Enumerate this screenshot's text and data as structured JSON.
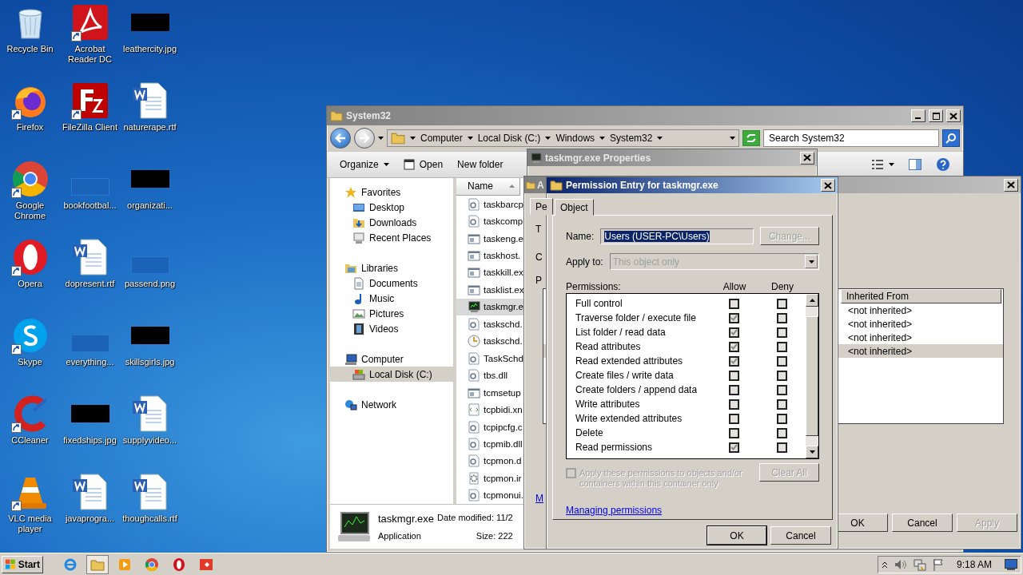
{
  "desktop_icons": [
    {
      "label": "Recycle Bin",
      "kind": "recycle",
      "shortcut": false
    },
    {
      "label": "Acrobat Reader DC",
      "kind": "pdf",
      "shortcut": true
    },
    {
      "label": "leathercity.jpg",
      "kind": "thumb-black",
      "shortcut": false
    },
    {
      "label": "Firefox",
      "kind": "firefox",
      "shortcut": true
    },
    {
      "label": "FileZilla Client",
      "kind": "filezilla",
      "shortcut": true
    },
    {
      "label": "naturerape.rtf",
      "kind": "word",
      "shortcut": false
    },
    {
      "label": "Google Chrome",
      "kind": "chrome",
      "shortcut": true
    },
    {
      "label": "bookfootbal...",
      "kind": "thumb-blue",
      "shortcut": false
    },
    {
      "label": "organizati...",
      "kind": "thumb-black",
      "shortcut": false
    },
    {
      "label": "Opera",
      "kind": "opera",
      "shortcut": true
    },
    {
      "label": "dopresent.rtf",
      "kind": "word",
      "shortcut": false
    },
    {
      "label": "passend.png",
      "kind": "thumb-blue",
      "shortcut": false
    },
    {
      "label": "Skype",
      "kind": "skype",
      "shortcut": true
    },
    {
      "label": "everything...",
      "kind": "thumb-blue",
      "shortcut": false
    },
    {
      "label": "skillsgirls.jpg",
      "kind": "thumb-black",
      "shortcut": false
    },
    {
      "label": "CCleaner",
      "kind": "ccleaner",
      "shortcut": true
    },
    {
      "label": "fixedships.jpg",
      "kind": "thumb-black",
      "shortcut": false
    },
    {
      "label": "supplyvideo...",
      "kind": "word",
      "shortcut": false
    },
    {
      "label": "VLC media player",
      "kind": "vlc",
      "shortcut": true
    },
    {
      "label": "javaprogra...",
      "kind": "word",
      "shortcut": false
    },
    {
      "label": "thoughcalls.rtf",
      "kind": "word",
      "shortcut": false
    }
  ],
  "explorer": {
    "title": "System32",
    "breadcrumb": [
      "Computer",
      "Local Disk (C:)",
      "Windows",
      "System32"
    ],
    "search": {
      "placeholder": "Search System32"
    },
    "toolbar": [
      {
        "label": "Organize",
        "kind": "menu"
      },
      {
        "label": "Open",
        "kind": "open"
      },
      {
        "label": "New folder",
        "kind": "plain"
      }
    ],
    "nav": [
      {
        "label": "Favorites",
        "kind": "star",
        "selected": false,
        "children": [
          {
            "label": "Desktop",
            "kind": "desktop",
            "selected": false
          },
          {
            "label": "Downloads",
            "kind": "downloads",
            "selected": false
          },
          {
            "label": "Recent Places",
            "kind": "recent",
            "selected": false
          }
        ]
      },
      {
        "label": "Libraries",
        "kind": "libraries",
        "selected": false,
        "children": [
          {
            "label": "Documents",
            "kind": "documents",
            "selected": false
          },
          {
            "label": "Music",
            "kind": "music",
            "selected": false
          },
          {
            "label": "Pictures",
            "kind": "pictures",
            "selected": false
          },
          {
            "label": "Videos",
            "kind": "videos",
            "selected": false
          }
        ]
      },
      {
        "label": "Computer",
        "kind": "computer",
        "selected": false,
        "children": [
          {
            "label": "Local Disk (C:)",
            "kind": "disk",
            "selected": true
          }
        ]
      },
      {
        "label": "Network",
        "kind": "network",
        "selected": false
      }
    ],
    "name_column": "Name",
    "files": [
      {
        "name": "taskbarcp",
        "kind": "dll",
        "selected": false
      },
      {
        "name": "taskcomp",
        "kind": "dll",
        "selected": false
      },
      {
        "name": "taskeng.e",
        "kind": "exe",
        "selected": false
      },
      {
        "name": "taskhost.",
        "kind": "exe",
        "selected": false
      },
      {
        "name": "taskkill.ex",
        "kind": "exe",
        "selected": false
      },
      {
        "name": "tasklist.ex",
        "kind": "exe",
        "selected": false
      },
      {
        "name": "taskmgr.e",
        "kind": "monitor",
        "selected": true
      },
      {
        "name": "taskschd.",
        "kind": "dll",
        "selected": false
      },
      {
        "name": "taskschd.",
        "kind": "clock",
        "selected": false
      },
      {
        "name": "TaskSchd",
        "kind": "dll",
        "selected": false
      },
      {
        "name": "tbs.dll",
        "kind": "dll",
        "selected": false
      },
      {
        "name": "tcmsetup",
        "kind": "exe",
        "selected": false
      },
      {
        "name": "tcpbidi.xn",
        "kind": "xml",
        "selected": false
      },
      {
        "name": "tcpipcfg.c",
        "kind": "dll",
        "selected": false
      },
      {
        "name": "tcpmib.dll",
        "kind": "dll",
        "selected": false
      },
      {
        "name": "tcpmon.d",
        "kind": "dll",
        "selected": false
      },
      {
        "name": "tcpmon.ir",
        "kind": "inf",
        "selected": false
      },
      {
        "name": "tcpmonui.",
        "kind": "dll",
        "selected": false
      }
    ],
    "details": {
      "name": "taskmgr.exe",
      "type": "Application",
      "date_modified": "Date modified: 11/2",
      "size": "Size: 222"
    }
  },
  "properties_window": {
    "title": "taskmgr.exe Properties"
  },
  "advanced_window": {
    "title": "A",
    "tab": "Pe",
    "labels": [
      "T",
      "C",
      "P"
    ],
    "column": "Inherited From",
    "rows": [
      {
        "inherited_from": "<not inherited>",
        "selected": false
      },
      {
        "inherited_from": "<not inherited>",
        "selected": false
      },
      {
        "inherited_from": "<not inherited>",
        "selected": false
      },
      {
        "inherited_from": "<not inherited>",
        "selected": true
      }
    ],
    "link": "M",
    "buttons": [
      {
        "label": "OK",
        "disabled": false
      },
      {
        "label": "Cancel",
        "disabled": false
      },
      {
        "label": "Apply",
        "disabled": true
      }
    ]
  },
  "permission_entry": {
    "title": "Permission Entry for taskmgr.exe",
    "tab": "Object",
    "name_label": "Name:",
    "name_value": "Users (USER-PC\\Users)",
    "change_button": {
      "label": "Change...",
      "disabled": true
    },
    "apply_label": "Apply to:",
    "apply_value": "This object only",
    "permissions_label": "Permissions:",
    "allow_label": "Allow",
    "deny_label": "Deny",
    "permissions": [
      {
        "name": "Full control",
        "allow": false,
        "deny": false
      },
      {
        "name": "Traverse folder / execute file",
        "allow": true,
        "deny": false
      },
      {
        "name": "List folder / read data",
        "allow": true,
        "deny": false
      },
      {
        "name": "Read attributes",
        "allow": true,
        "deny": false
      },
      {
        "name": "Read extended attributes",
        "allow": true,
        "deny": false
      },
      {
        "name": "Create files / write data",
        "allow": false,
        "deny": false
      },
      {
        "name": "Create folders / append data",
        "allow": false,
        "deny": false
      },
      {
        "name": "Write attributes",
        "allow": false,
        "deny": false
      },
      {
        "name": "Write extended attributes",
        "allow": false,
        "deny": false
      },
      {
        "name": "Delete",
        "allow": false,
        "deny": false
      },
      {
        "name": "Read permissions",
        "allow": true,
        "deny": false
      }
    ],
    "apply_inside": {
      "label": "Apply these permissions to objects and/or containers within this container only",
      "checked": false,
      "disabled": true
    },
    "clear_all": {
      "label": "Clear All",
      "disabled": true
    },
    "link": "Managing permissions",
    "buttons": [
      {
        "label": "OK",
        "default": true
      },
      {
        "label": "Cancel",
        "default": false
      }
    ]
  },
  "taskbar": {
    "start": "Start",
    "apps": [
      {
        "kind": "ie",
        "selected": false
      },
      {
        "kind": "folder",
        "selected": true
      },
      {
        "kind": "media",
        "selected": false
      },
      {
        "kind": "chrome",
        "selected": false
      },
      {
        "kind": "opera",
        "selected": false
      },
      {
        "kind": "record",
        "selected": false
      }
    ],
    "clock": "9:18 AM"
  }
}
